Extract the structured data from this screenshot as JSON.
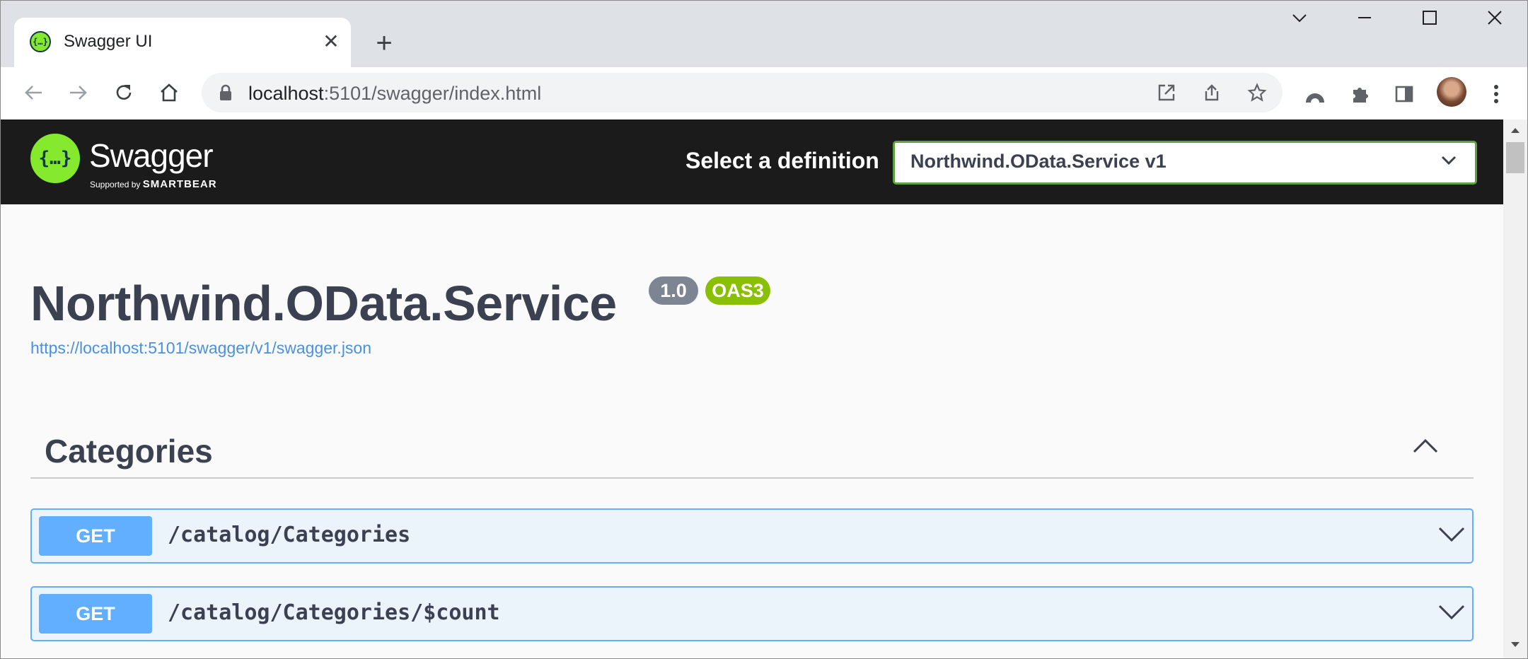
{
  "browser": {
    "tab": {
      "title": "Swagger UI",
      "close_glyph": "✕",
      "favicon_text": "{…}"
    },
    "new_tab_glyph": "+",
    "window_controls": {
      "list_tabs_glyph": "⌄",
      "minimize_glyph": "—",
      "maximize_glyph": "☐",
      "close_glyph": "✕"
    },
    "address": {
      "host": "localhost",
      "rest": ":5101/swagger/index.html"
    }
  },
  "swagger": {
    "logo_text": "Swagger",
    "logo_glyph": "{…}",
    "logo_sub_prefix": "Supported by",
    "logo_sub_brand": "SMARTBEAR",
    "select_label": "Select a definition",
    "select_value": "Northwind.OData.Service v1"
  },
  "info": {
    "title": "Northwind.OData.Service",
    "version_badge": "1.0",
    "oas_badge": "OAS3",
    "url": "https://localhost:5101/swagger/v1/swagger.json"
  },
  "tag": {
    "title": "Categories"
  },
  "operations": [
    {
      "method": "GET",
      "path": "/catalog/Categories"
    },
    {
      "method": "GET",
      "path": "/catalog/Categories/$count"
    }
  ],
  "colors": {
    "get_method": "#61affe",
    "get_background": "#ebf3fb",
    "swagger_green": "#85ea2d",
    "version_badge": "#7d8492",
    "oas_badge": "#89bf04",
    "link": "#4990e2",
    "topbar": "#1b1b1b"
  }
}
